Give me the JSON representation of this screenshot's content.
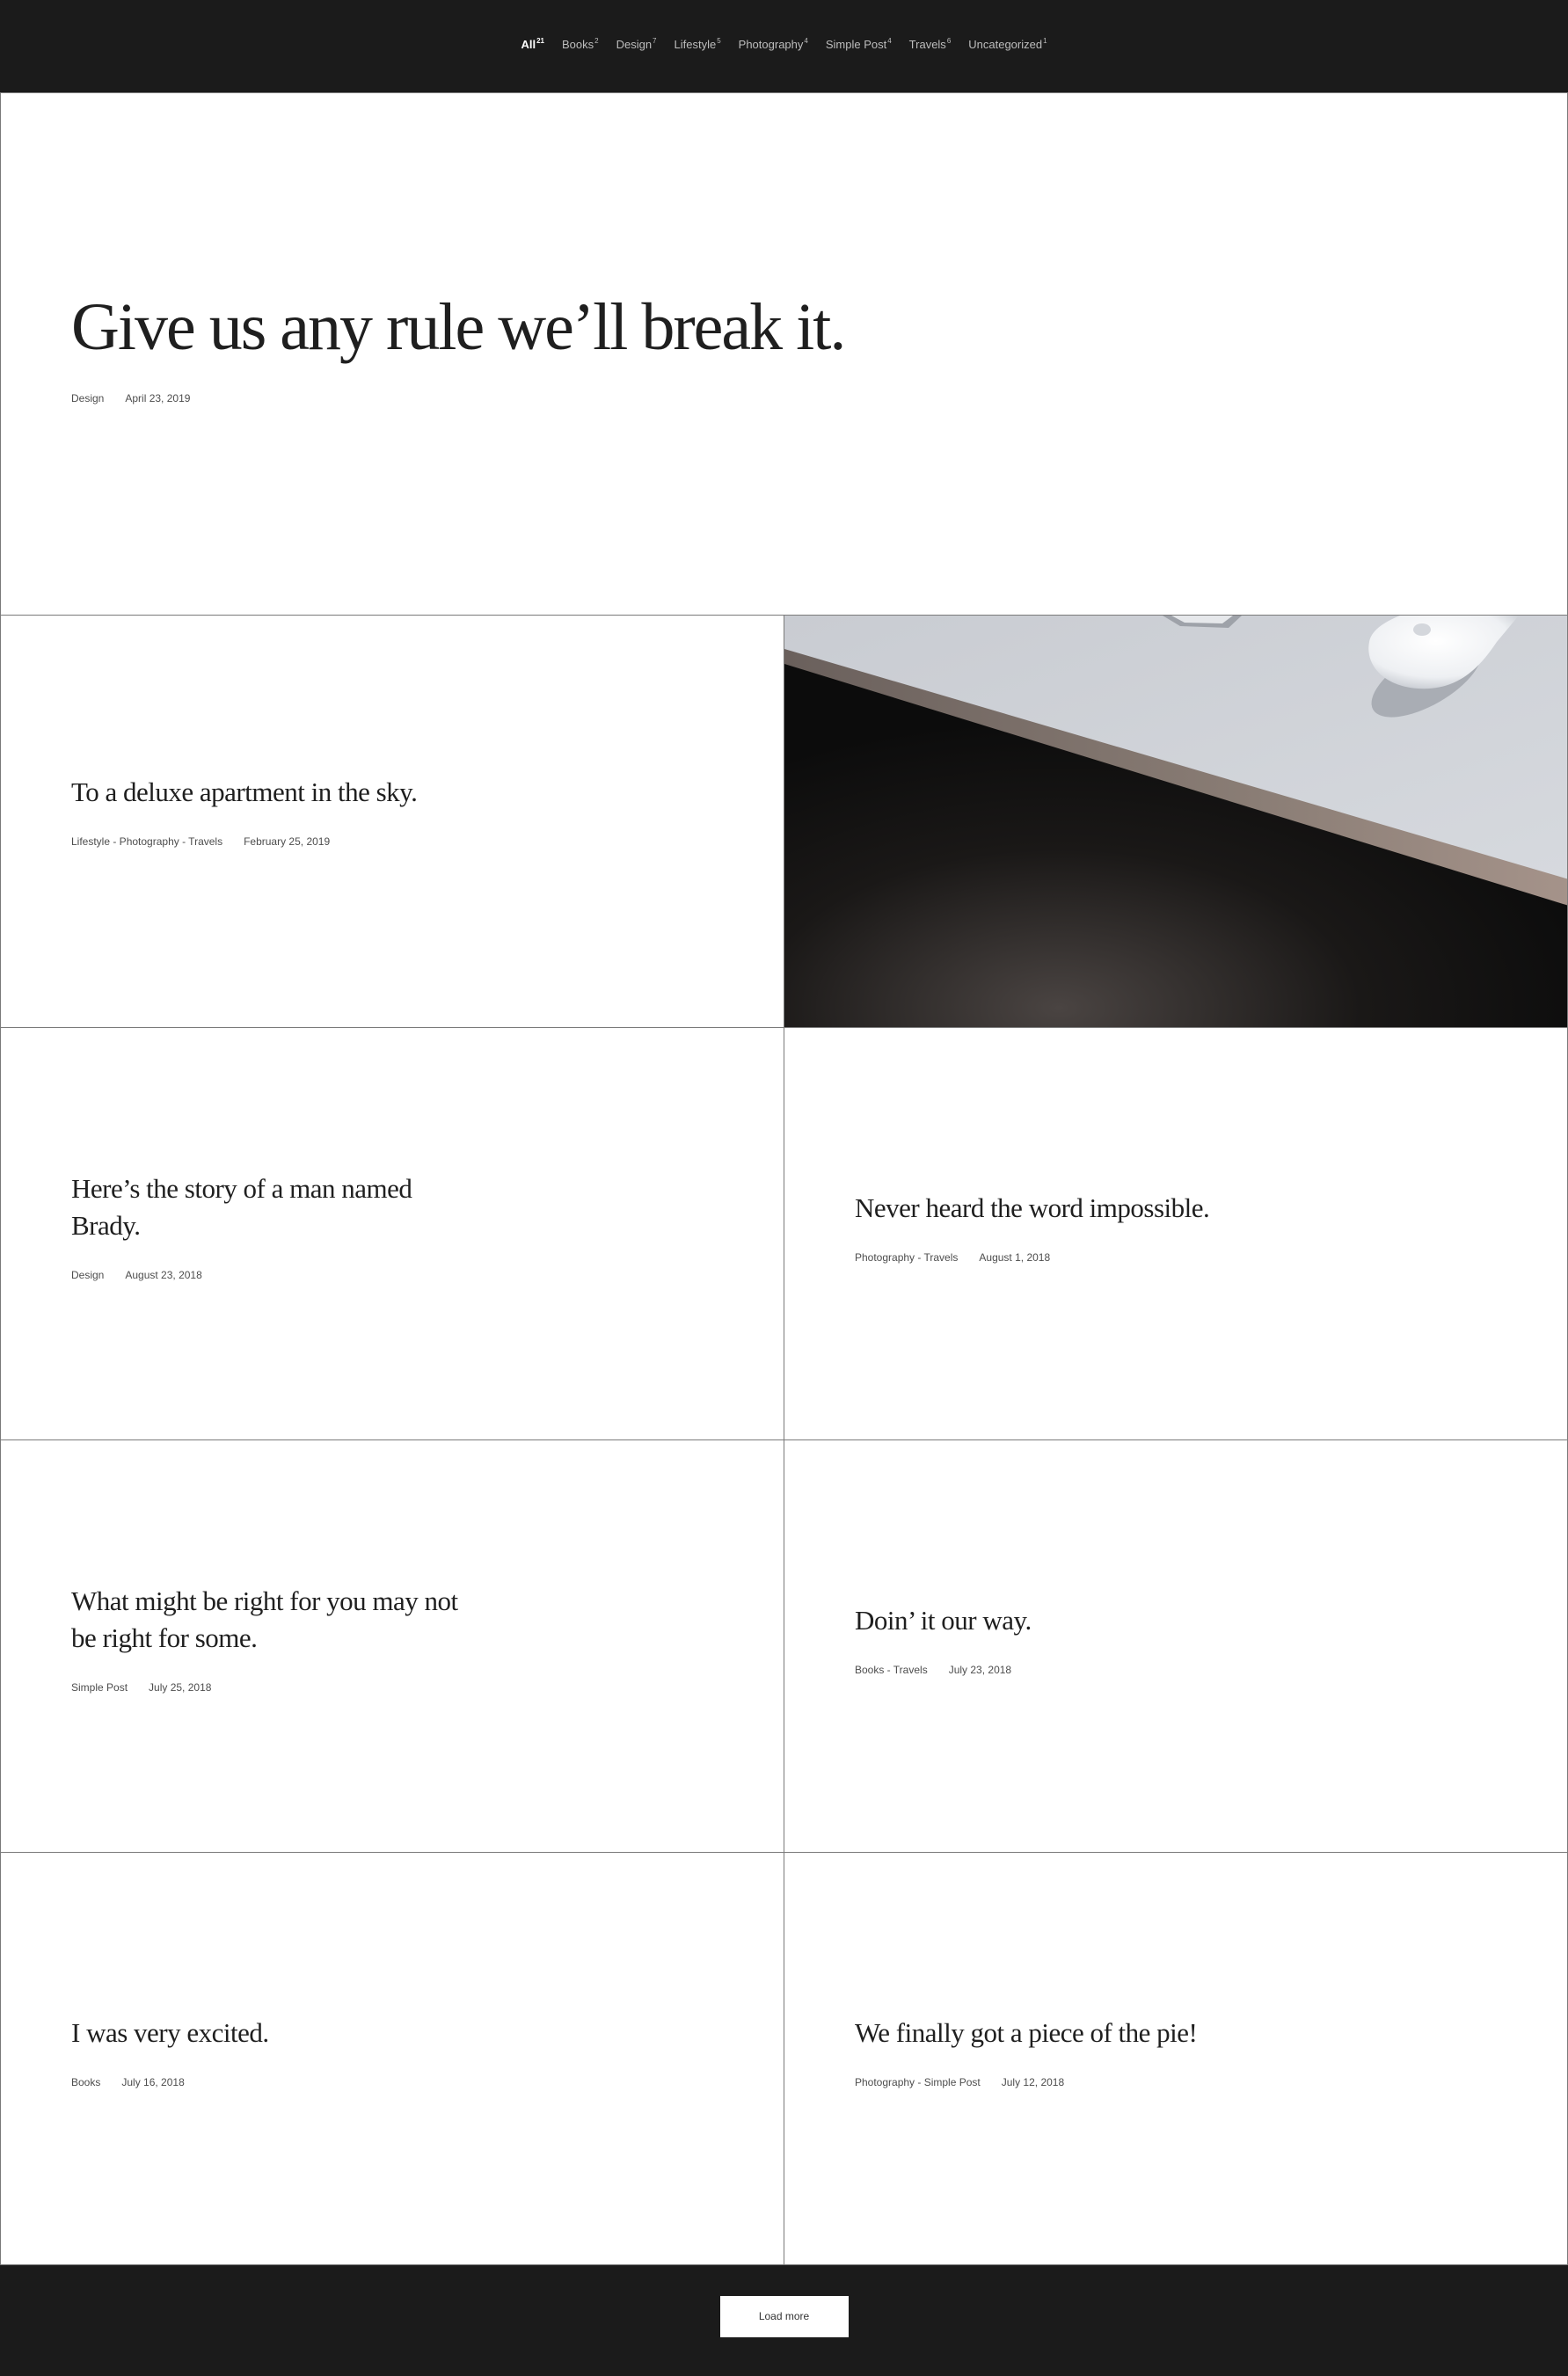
{
  "filters": [
    {
      "label": "All",
      "count": "21"
    },
    {
      "label": "Books",
      "count": "2"
    },
    {
      "label": "Design",
      "count": "7"
    },
    {
      "label": "Lifestyle",
      "count": "5"
    },
    {
      "label": "Photography",
      "count": "4"
    },
    {
      "label": "Simple Post",
      "count": "4"
    },
    {
      "label": "Travels",
      "count": "6"
    },
    {
      "label": "Uncategorized",
      "count": "1"
    }
  ],
  "posts": [
    {
      "title": "Give us any rule we’ll break it.",
      "categories": "Design",
      "date": "April 23, 2019"
    },
    {
      "title": "To a deluxe apartment in the sky.",
      "categories": "Lifestyle - Photography - Travels",
      "date": "February 25, 2019"
    },
    {
      "title": "Here’s the story of a man named Brady.",
      "categories": "Design",
      "date": "August 23, 2018"
    },
    {
      "title": "Never heard the word impossible.",
      "categories": "Photography - Travels",
      "date": "August 1, 2018"
    },
    {
      "title": "What might be right for you may not be right for some.",
      "categories": "Simple Post",
      "date": "July 25, 2018"
    },
    {
      "title": "Doin’ it our way.",
      "categories": "Books - Travels",
      "date": "July 23, 2018"
    },
    {
      "title": "I was very excited.",
      "categories": "Books",
      "date": "July 16, 2018"
    },
    {
      "title": "We finally got a piece of the pie!",
      "categories": "Photography - Simple Post",
      "date": "July 12, 2018"
    }
  ],
  "load_more_label": "Load more",
  "colors": {
    "background_dark": "#1b1b1b",
    "tile_background": "#ffffff",
    "border": "#7a7a7a"
  }
}
